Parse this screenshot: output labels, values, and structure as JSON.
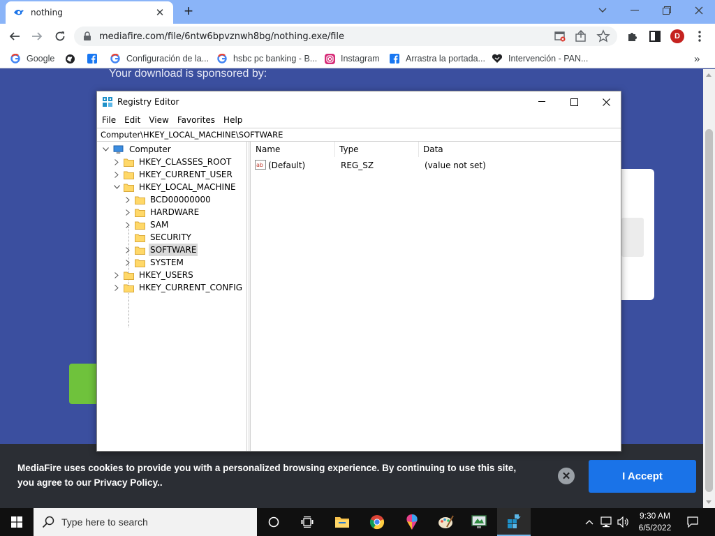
{
  "browser": {
    "tab": {
      "title": "nothing"
    },
    "url": "mediafire.com/file/6ntw6bpvznwh8bg/nothing.exe/file",
    "avatar_initial": "D",
    "bookmarks": [
      {
        "label": "Google",
        "icon": "google-icon"
      },
      {
        "label": "",
        "icon": "globe-icon"
      },
      {
        "label": "",
        "icon": "facebook-icon"
      },
      {
        "label": "Configuración de la...",
        "icon": "google-icon"
      },
      {
        "label": "hsbc pc banking - B...",
        "icon": "google-icon"
      },
      {
        "label": "Instagram",
        "icon": "instagram-icon"
      },
      {
        "label": "Arrastra la portada...",
        "icon": "facebook-icon"
      },
      {
        "label": "Intervención - PAN...",
        "icon": "heart-icon"
      }
    ],
    "overflow": "»"
  },
  "page": {
    "sponsor_text": "Your download is sponsored by:",
    "cookie": {
      "text": "MediaFire uses cookies to provide you with a personalized browsing experience. By continuing to use this site, you agree to our Privacy Policy..",
      "accept_label": "I Accept",
      "close_label": "✕"
    }
  },
  "regedit": {
    "title": "Registry Editor",
    "menu": [
      "File",
      "Edit",
      "View",
      "Favorites",
      "Help"
    ],
    "address": "Computer\\HKEY_LOCAL_MACHINE\\SOFTWARE",
    "tree": {
      "root": "Computer",
      "hives": [
        "HKEY_CLASSES_ROOT",
        "HKEY_CURRENT_USER",
        "HKEY_LOCAL_MACHINE",
        "HKEY_USERS",
        "HKEY_CURRENT_CONFIG"
      ],
      "hklm_children": [
        "BCD00000000",
        "HARDWARE",
        "SAM",
        "SECURITY",
        "SOFTWARE",
        "SYSTEM"
      ],
      "selected": "SOFTWARE"
    },
    "columns": [
      "Name",
      "Type",
      "Data"
    ],
    "rows": [
      {
        "name": "(Default)",
        "type": "REG_SZ",
        "data": "(value not set)"
      }
    ]
  },
  "taskbar": {
    "search_placeholder": "Type here to search",
    "time": "9:30 AM",
    "date": "6/5/2022"
  },
  "colors": {
    "page_bg": "#3b4f9f",
    "tabstrip": "#8ab4f8",
    "accept_btn": "#1a73e8",
    "cookie_bg": "#2b2e34",
    "green_btn": "#6fc23c"
  }
}
